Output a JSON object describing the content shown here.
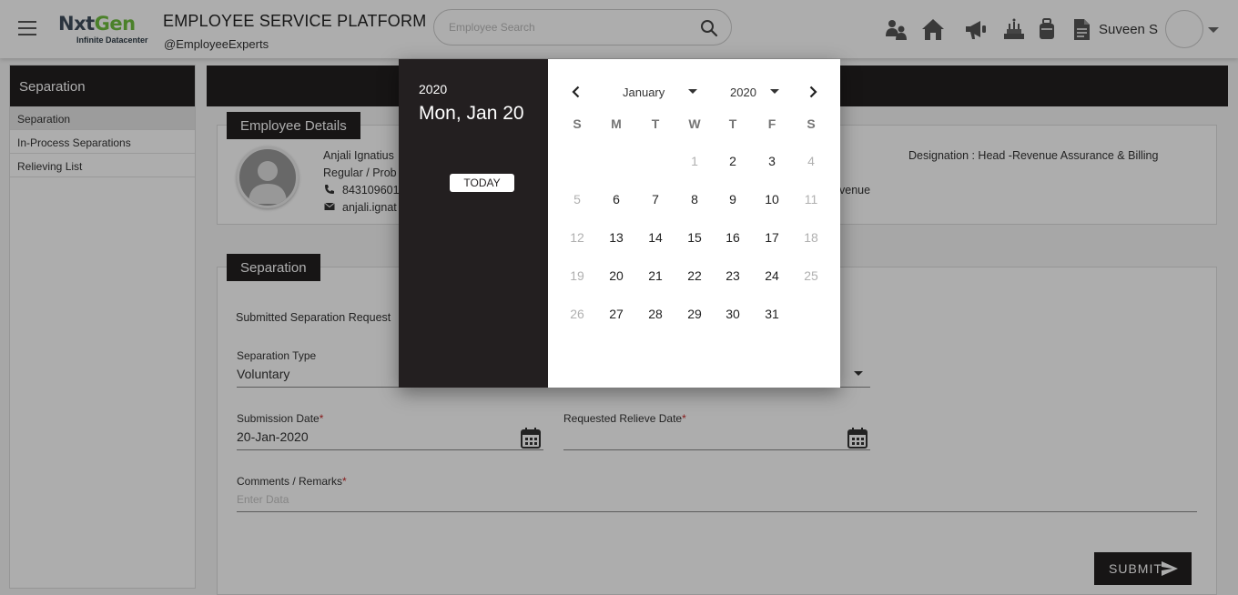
{
  "header": {
    "logo_main": "NxtGen",
    "logo_sub": "Infinite Datacenter",
    "app_title": "EMPLOYEE SERVICE PLATFORM",
    "app_subtitle": "@EmployeeExperts",
    "search_placeholder": "Employee Search",
    "user_name": "Suveen S",
    "icons": [
      "team-icon",
      "home-icon",
      "announcement-icon",
      "celebration-icon",
      "luggage-icon",
      "document-icon"
    ]
  },
  "sidebar": {
    "title": "Separation",
    "items": [
      {
        "label": "Separation",
        "active": true
      },
      {
        "label": "In-Process Separations",
        "active": false
      },
      {
        "label": "Relieving List",
        "active": false
      }
    ]
  },
  "employee_card": {
    "tab_label": "Employee Details",
    "name": "Anjali Ignatius",
    "employment_type": "Regular / Prob",
    "phone": "843109601",
    "email": "anjali.ignat",
    "designation": "Designation : Head -Revenue Assurance & Billing",
    "department_fragment": "venue"
  },
  "separation_card": {
    "tab_label": "Separation",
    "submitted_text": "Submitted Separation Request",
    "separation_type_label": "Separation Type",
    "separation_type_value": "Voluntary",
    "submission_date_label": "Submission Date",
    "submission_date_value": "20-Jan-2020",
    "relieve_date_label": "Requested Relieve Date",
    "remarks_label": "Comments / Remarks",
    "remarks_placeholder": "Enter Data",
    "submit_label": "SUBMIT"
  },
  "datepicker": {
    "year": "2020",
    "selected_date": "Mon, Jan 20",
    "today_label": "TODAY",
    "month_select": "January",
    "year_select": "2020",
    "weekdays": [
      "S",
      "M",
      "T",
      "W",
      "T",
      "F",
      "S"
    ],
    "weeks": [
      [
        "",
        "",
        "",
        "1",
        "2",
        "3",
        "4"
      ],
      [
        "5",
        "6",
        "7",
        "8",
        "9",
        "10",
        "11"
      ],
      [
        "12",
        "13",
        "14",
        "15",
        "16",
        "17",
        "18"
      ],
      [
        "19",
        "20",
        "21",
        "22",
        "23",
        "24",
        "25"
      ],
      [
        "26",
        "27",
        "28",
        "29",
        "30",
        "31",
        ""
      ]
    ],
    "disabled_days": [
      "1",
      "4",
      "5",
      "11",
      "12",
      "18",
      "19",
      "25",
      "26"
    ]
  },
  "colors": {
    "dark": "#231f20",
    "brand_green": "#6fbf3f",
    "brand_slate": "#3e4d5c",
    "required": "#c62828"
  }
}
